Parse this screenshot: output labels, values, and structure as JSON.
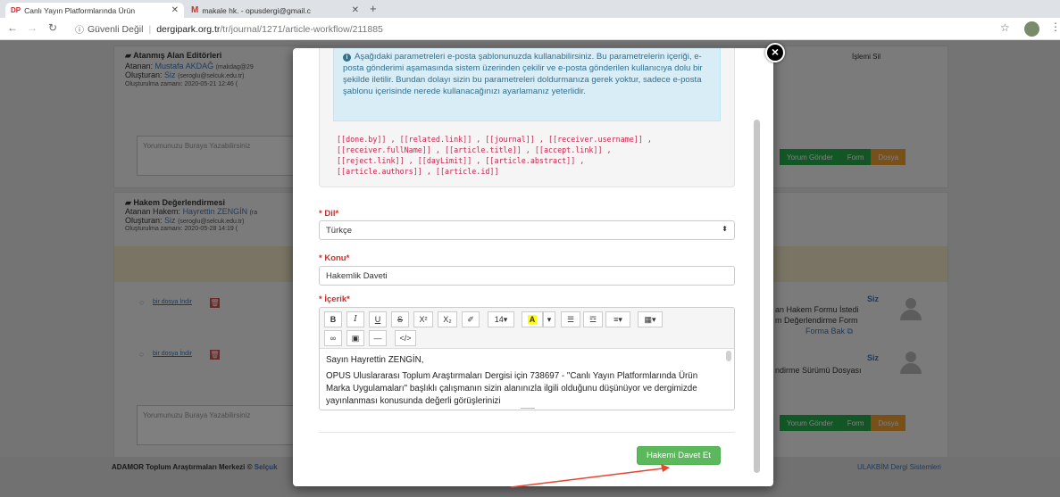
{
  "browser": {
    "tabs": [
      {
        "favicon": "DP",
        "title": "Canlı Yayın Platformlarında Ürün"
      },
      {
        "favicon": "M",
        "title": "makale hk. - opusdergi@gmail.c"
      }
    ],
    "security_text": "Güvenli Değil",
    "url_host": "dergipark.org.tr",
    "url_path": "/tr/journal/1271/article-workflow/211885"
  },
  "background": {
    "editors_panel": {
      "title": "Atanmış Alan Editörleri",
      "assignee_label": "Atanan:",
      "assignee": "Mustafa AKDAĞ",
      "assignee_email": "(makdag@29",
      "created_by_label": "Oluşturan:",
      "created_by": "Siz",
      "created_by_email": "(seroglu@selcuk.edu.tr)",
      "created_at": "Oluşturulma zamanı: 2020-05-21 12:46 (",
      "delete_button": "İşlemi Sil"
    },
    "comment_placeholder": "Yorumunuzu Buraya Yazabilirsiniz",
    "comment_buttons": [
      "Yorum Gönder",
      "Form",
      "Dosya"
    ],
    "referee_panel": {
      "title": "Hakem Değerlendirmesi",
      "assignee_label": "Atanan Hakem:",
      "assignee": "Hayrettin ZENGİN",
      "assignee_email": "(ra",
      "created_by_label": "Oluşturan:",
      "created_by": "Siz",
      "created_by_email": "(seroglu@selcuk.edu.tr)",
      "created_at": "Oluşturulma zamanı: 2020-05-28 14:19 ("
    },
    "download_link": "bir dosya İndir",
    "right_entries": [
      {
        "who": "Siz",
        "line1": "an Hakem Formu İstedi",
        "line2": "m Değerlendirme Form",
        "line3": "Forma Bak"
      },
      {
        "who": "Siz",
        "line1": "ndirme Sürümü Dosyası"
      }
    ],
    "footer_left": "ADAMOR Toplum Araştırmaları Merkezi ©",
    "footer_left_link": "Selçuk",
    "footer_right": "ULAKBİM Dergi Sistemleri"
  },
  "modal": {
    "info_text": "Aşağıdaki parametreleri e-posta şablonunuzda kullanabilirsiniz. Bu parametrelerin içeriği, e-posta gönderimi aşamasında sistem üzerinden çekilir ve e-posta gönderilen kullanıcıya dolu bir şekilde iletilir. Bundan dolayı sizin bu parametreleri doldurmanıza gerek yoktur, sadece e-posta şablonu içerisinde nerede kullanacağınızı ayarlamanız yeterlidir.",
    "variables_line1": "[[done.by]] , [[related.link]] , [[journal]] , [[receiver.username]] ,",
    "variables_line2": "[[receiver.fullName]] , [[article.title]] , [[accept.link]] ,",
    "variables_line3": "[[reject.link]] , [[dayLimit]] , [[article.abstract]] ,",
    "variables_line4": "[[article.authors]] , [[article.id]]",
    "language_label": "* Dil*",
    "language_value": "Türkçe",
    "subject_label": "* Konu*",
    "subject_value": "Hakemlik Daveti",
    "content_label": "* İçerik*",
    "toolbar": {
      "bold": "B",
      "italic": "I",
      "underline": "U",
      "strike": "S",
      "superscript": "X²",
      "subscript": "X₂",
      "eraser": "✐",
      "font_size": "14▾",
      "highlight": "A",
      "caret": "▾",
      "ul": "☰",
      "ol": "☲",
      "align": "≡▾",
      "table": "▦▾",
      "link": "∞",
      "image": "▣",
      "hr": "—",
      "code": "</>"
    },
    "greeting": "Sayın Hayrettin ZENGİN,",
    "body": "OPUS Uluslararası Toplum Araştırmaları Dergisi için 738697 - \"Canlı Yayın Platformlarında Ürün Marka Uygulamaları\" başlıklı çalışmanın sizin alanınızla ilgili olduğunu düşünüyor ve dergimizde yayınlanması konusunda değerli görüşlerinizi",
    "submit_button": "Hakemi Davet Et"
  },
  "colors": {
    "accent_green": "#5cb85c",
    "alert_blue": "#d9edf7",
    "label_red": "#c9302c",
    "variable_pink": "#c7254e",
    "arrow_red": "#e8442e"
  }
}
